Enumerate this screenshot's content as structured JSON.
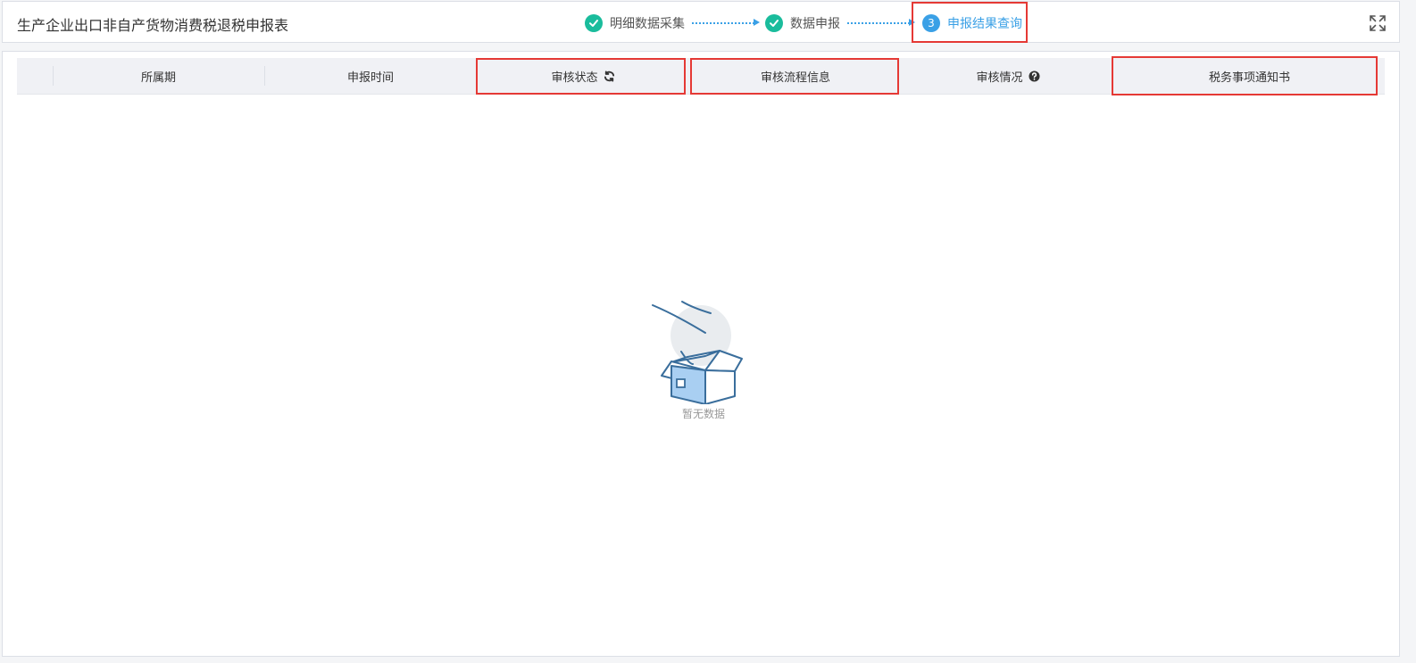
{
  "header": {
    "title": "生产企业出口非自产货物消费税退税申报表",
    "steps": [
      {
        "label": "明细数据采集",
        "state": "done"
      },
      {
        "label": "数据申报",
        "state": "done"
      },
      {
        "number": "3",
        "label": "申报结果查询",
        "state": "active"
      }
    ],
    "expand_icon": "fullscreen-icon"
  },
  "table": {
    "columns": [
      {
        "label": "所属期"
      },
      {
        "label": "申报时间"
      },
      {
        "label": "审核状态",
        "icon": "refresh-icon"
      },
      {
        "label": "审核流程信息"
      },
      {
        "label": "审核情况",
        "icon": "help-icon"
      },
      {
        "label": "税务事项通知书"
      }
    ],
    "rows": [],
    "empty_text": "暂无数据"
  },
  "colors": {
    "accent": "#3aa0e6",
    "done": "#1abc9c",
    "highlight": "#e53935",
    "header_bg": "#f0f1f5"
  }
}
